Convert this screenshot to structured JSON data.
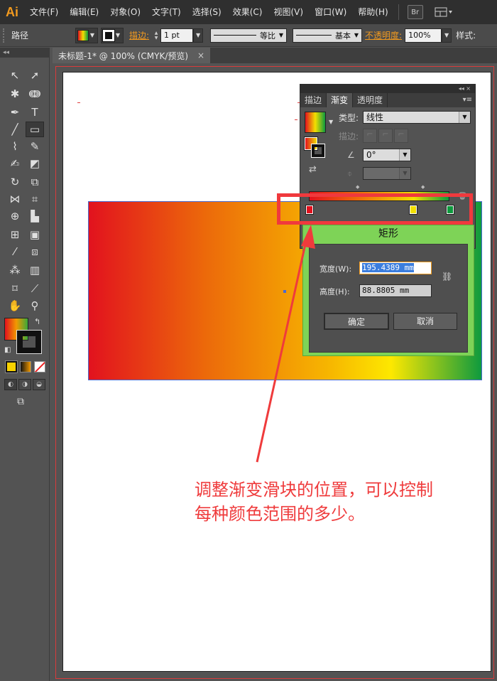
{
  "app": {
    "logo": "Ai",
    "menu": [
      "文件(F)",
      "编辑(E)",
      "对象(O)",
      "文字(T)",
      "选择(S)",
      "效果(C)",
      "视图(V)",
      "窗口(W)",
      "帮助(H)"
    ],
    "bridge_label": "Br"
  },
  "control": {
    "selection_label": "路径",
    "stroke_link": "描边:",
    "stroke_weight": "1 pt",
    "profile_label": "等比",
    "brush_label": "基本",
    "opacity_link": "不透明度:",
    "opacity_value": "100%",
    "style_label": "样式:"
  },
  "document": {
    "tab_title": "未标题-1* @ 100% (CMYK/预览)",
    "tab_close": "×"
  },
  "gradient_panel": {
    "collapse": "◂◂ ×",
    "tabs": [
      "描边",
      "渐变",
      "透明度"
    ],
    "active_tab": "渐变",
    "menu_icon": "▾≡",
    "type_label": "类型:",
    "type_value": "线性",
    "stroke_label": "描边:",
    "angle_value": "0°",
    "colors": {
      "stop1": "#e2121e",
      "stop2": "#f2e000",
      "stop3": "#0e9a3e"
    }
  },
  "dialog": {
    "title": "矩形",
    "width_label": "宽度(W):",
    "width_value": "195.4389 mm",
    "height_label": "高度(H):",
    "height_value": "88.8805 mm",
    "ok_label": "确定",
    "cancel_label": "取消"
  },
  "annotation": {
    "line1": "调整渐变滑块的位置，可以控制",
    "line2": "每种颜色范围的多少。"
  }
}
